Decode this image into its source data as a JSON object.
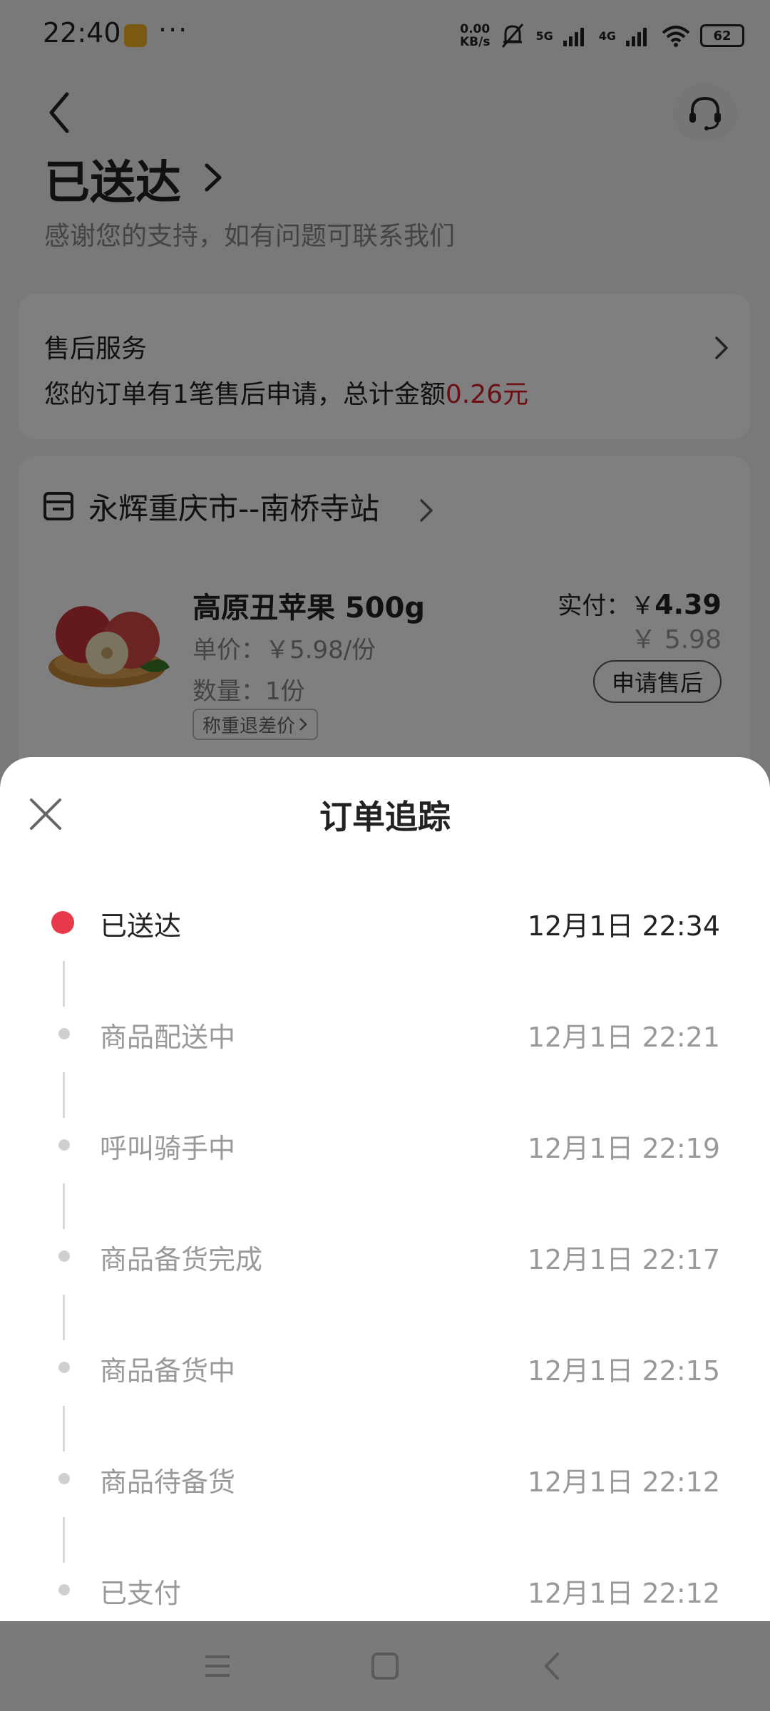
{
  "status_bar": {
    "time": "22:40",
    "speed_top": "0.00",
    "speed_bottom": "KB/s",
    "net1": "5G",
    "net2": "4G",
    "battery": "62"
  },
  "header": {
    "status_title": "已送达",
    "status_sub": "感谢您的支持，如有问题可联系我们"
  },
  "after_sales": {
    "title": "售后服务",
    "desc_prefix": "您的订单有1笔售后申请，总计金额",
    "amount": "0.26元"
  },
  "store": {
    "name": "永辉重庆市--南桥寺站"
  },
  "product": {
    "name": "高原丑苹果 500g",
    "unit_price": "单价：￥5.98/份",
    "quantity": "数量：1份",
    "tag": "称重退差价",
    "paid_label": "实付：￥",
    "paid_value": "4.39",
    "original_price": "￥ 5.98",
    "after_sale_button": "申请售后"
  },
  "sheet": {
    "title": "订单追踪",
    "events": [
      {
        "label": "已送达",
        "time": "12月1日 22:34",
        "active": true
      },
      {
        "label": "商品配送中",
        "time": "12月1日 22:21",
        "active": false
      },
      {
        "label": "呼叫骑手中",
        "time": "12月1日 22:19",
        "active": false
      },
      {
        "label": "商品备货完成",
        "time": "12月1日 22:17",
        "active": false
      },
      {
        "label": "商品备货中",
        "time": "12月1日 22:15",
        "active": false
      },
      {
        "label": "商品待备货",
        "time": "12月1日 22:12",
        "active": false
      },
      {
        "label": "已支付",
        "time": "12月1日 22:12",
        "active": false
      }
    ]
  },
  "colors": {
    "accent_red": "#e8394a",
    "amount_red": "#d81e2a"
  },
  "icons": {
    "back": "chevron-left-icon",
    "support": "headset-icon",
    "store": "store-icon",
    "close": "close-icon"
  }
}
